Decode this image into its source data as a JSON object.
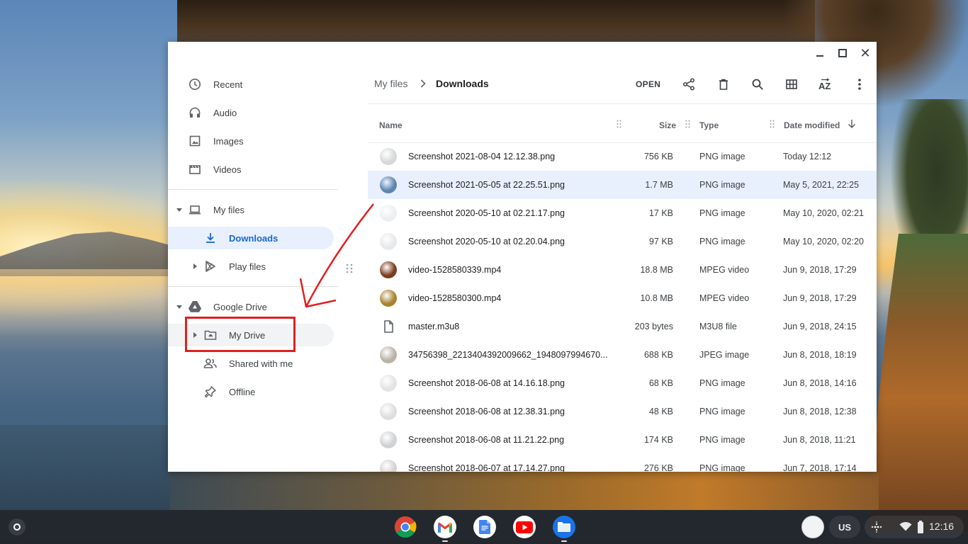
{
  "window": {
    "controls": {
      "minimize": "minimize-icon",
      "maximize": "maximize-icon",
      "close": "close-icon"
    }
  },
  "sidebar": {
    "items": [
      {
        "label": "Recent",
        "icon": "clock-icon"
      },
      {
        "label": "Audio",
        "icon": "headphones-icon"
      },
      {
        "label": "Images",
        "icon": "image-icon"
      },
      {
        "label": "Videos",
        "icon": "video-icon"
      }
    ],
    "my_files": {
      "label": "My files",
      "icon": "laptop-icon"
    },
    "downloads": {
      "label": "Downloads",
      "icon": "download-icon"
    },
    "play_files": {
      "label": "Play files",
      "icon": "play-store-icon"
    },
    "google_drive": {
      "label": "Google Drive",
      "icon": "drive-icon"
    },
    "my_drive": {
      "label": "My Drive",
      "icon": "drive-folder-icon"
    },
    "shared": {
      "label": "Shared with me",
      "icon": "people-icon"
    },
    "offline": {
      "label": "Offline",
      "icon": "pin-icon"
    }
  },
  "breadcrumb": {
    "parent": "My files",
    "separator": ">",
    "current": "Downloads"
  },
  "toolbar": {
    "open_label": "OPEN",
    "icons": [
      "share-icon",
      "trash-icon",
      "search-icon",
      "grid-view-icon",
      "sort-az-icon",
      "more-vert-icon"
    ]
  },
  "columns": {
    "name": "Name",
    "size": "Size",
    "type": "Type",
    "date": "Date modified"
  },
  "files": [
    {
      "name": "Screenshot 2021-08-04 12.12.38.png",
      "size": "756 KB",
      "type": "PNG image",
      "date": "Today 12:12",
      "selected": false,
      "thumb": "#d6d8da"
    },
    {
      "name": "Screenshot 2021-05-05 at 22.25.51.png",
      "size": "1.7 MB",
      "type": "PNG image",
      "date": "May 5, 2021, 22:25",
      "selected": true,
      "thumb": "#5c86b0"
    },
    {
      "name": "Screenshot 2020-05-10 at 02.21.17.png",
      "size": "17 KB",
      "type": "PNG image",
      "date": "May 10, 2020, 02:21",
      "selected": false,
      "thumb": "#eceff1"
    },
    {
      "name": "Screenshot 2020-05-10 at 02.20.04.png",
      "size": "97 KB",
      "type": "PNG image",
      "date": "May 10, 2020, 02:20",
      "selected": false,
      "thumb": "#e6e8ea"
    },
    {
      "name": "video-1528580339.mp4",
      "size": "18.8 MB",
      "type": "MPEG video",
      "date": "Jun 9, 2018, 17:29",
      "selected": false,
      "thumb": "#7a3c1e"
    },
    {
      "name": "video-1528580300.mp4",
      "size": "10.8 MB",
      "type": "MPEG video",
      "date": "Jun 9, 2018, 17:29",
      "selected": false,
      "thumb": "#a8822e"
    },
    {
      "name": "master.m3u8",
      "size": "203 bytes",
      "type": "M3U8 file",
      "date": "Jun 9, 2018, 24:15",
      "selected": false,
      "thumb": "file"
    },
    {
      "name": "34756398_2213404392009662_1948097994670...",
      "size": "688 KB",
      "type": "JPEG image",
      "date": "Jun 8, 2018, 18:19",
      "selected": false,
      "thumb": "#b9b2a6"
    },
    {
      "name": "Screenshot 2018-06-08 at 14.16.18.png",
      "size": "68 KB",
      "type": "PNG image",
      "date": "Jun 8, 2018, 14:16",
      "selected": false,
      "thumb": "#e4e4e4"
    },
    {
      "name": "Screenshot 2018-06-08 at 12.38.31.png",
      "size": "48 KB",
      "type": "PNG image",
      "date": "Jun 8, 2018, 12:38",
      "selected": false,
      "thumb": "#dedede"
    },
    {
      "name": "Screenshot 2018-06-08 at 11.21.22.png",
      "size": "174 KB",
      "type": "PNG image",
      "date": "Jun 8, 2018, 11:21",
      "selected": false,
      "thumb": "#cfd2d4"
    },
    {
      "name": "Screenshot 2018-06-07 at 17.14.27.png",
      "size": "276 KB",
      "type": "PNG image",
      "date": "Jun 7, 2018, 17:14",
      "selected": false,
      "thumb": "#d9d2d2"
    }
  ],
  "shelf": {
    "apps": [
      "chrome-icon",
      "gmail-icon",
      "docs-icon",
      "youtube-icon",
      "files-icon"
    ],
    "ime": "US",
    "clock": "12:16"
  },
  "colors": {
    "accent": "#1a73e8",
    "selected_bg": "#e8f0fe",
    "annotation": "#e02020"
  }
}
